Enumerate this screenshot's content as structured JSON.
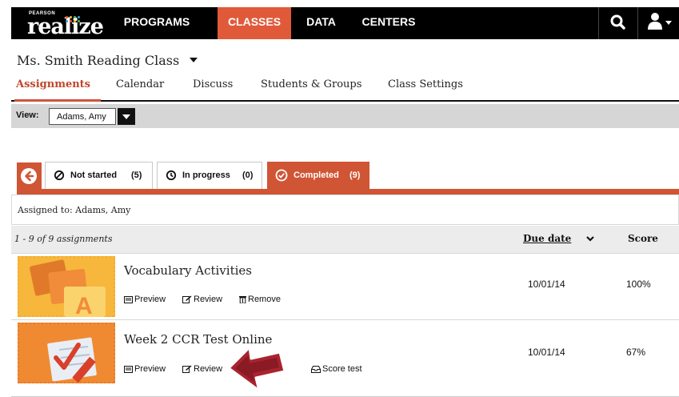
{
  "nav": {
    "brand_small": "PEARSON",
    "brand": "realize",
    "items": [
      {
        "label": "PROGRAMS"
      },
      {
        "label": "CLASSES"
      },
      {
        "label": "DATA"
      },
      {
        "label": "CENTERS"
      }
    ],
    "active": "CLASSES",
    "accent_color": "#e05a3a"
  },
  "class": {
    "title": "Ms. Smith Reading Class",
    "tabs": [
      {
        "label": "Assignments"
      },
      {
        "label": "Calendar"
      },
      {
        "label": "Discuss"
      },
      {
        "label": "Students & Groups"
      },
      {
        "label": "Class Settings"
      }
    ],
    "active_tab": "Assignments"
  },
  "view": {
    "label": "View:",
    "selected": "Adams, Amy"
  },
  "status_tabs": {
    "not_started": {
      "label": "Not started",
      "count": "(5)"
    },
    "in_progress": {
      "label": "In progress",
      "count": "(0)"
    },
    "completed": {
      "label": "Completed",
      "count": "(9)"
    }
  },
  "assigned_to": "Assigned to: Adams, Amy",
  "list": {
    "count_text": "1 - 9 of 9 assignments",
    "due_header": "Due date",
    "score_header": "Score"
  },
  "assignments": [
    {
      "title": "Vocabulary Activities",
      "actions": [
        "Preview",
        "Review",
        "Remove"
      ],
      "due": "10/01/14",
      "score": "100%"
    },
    {
      "title": "Week 2 CCR Test Online",
      "actions": [
        "Preview",
        "Review",
        "Score test"
      ],
      "due": "10/01/14",
      "score": "67%"
    }
  ],
  "icons": {
    "search": "search-icon",
    "user": "user-icon",
    "back": "back-arrow-icon",
    "not_started": "prohibited-icon",
    "in_progress": "clock-icon",
    "completed": "check-circle-icon",
    "preview": "preview-icon",
    "review": "edit-icon",
    "remove": "trash-icon",
    "score_test": "inbox-icon"
  }
}
